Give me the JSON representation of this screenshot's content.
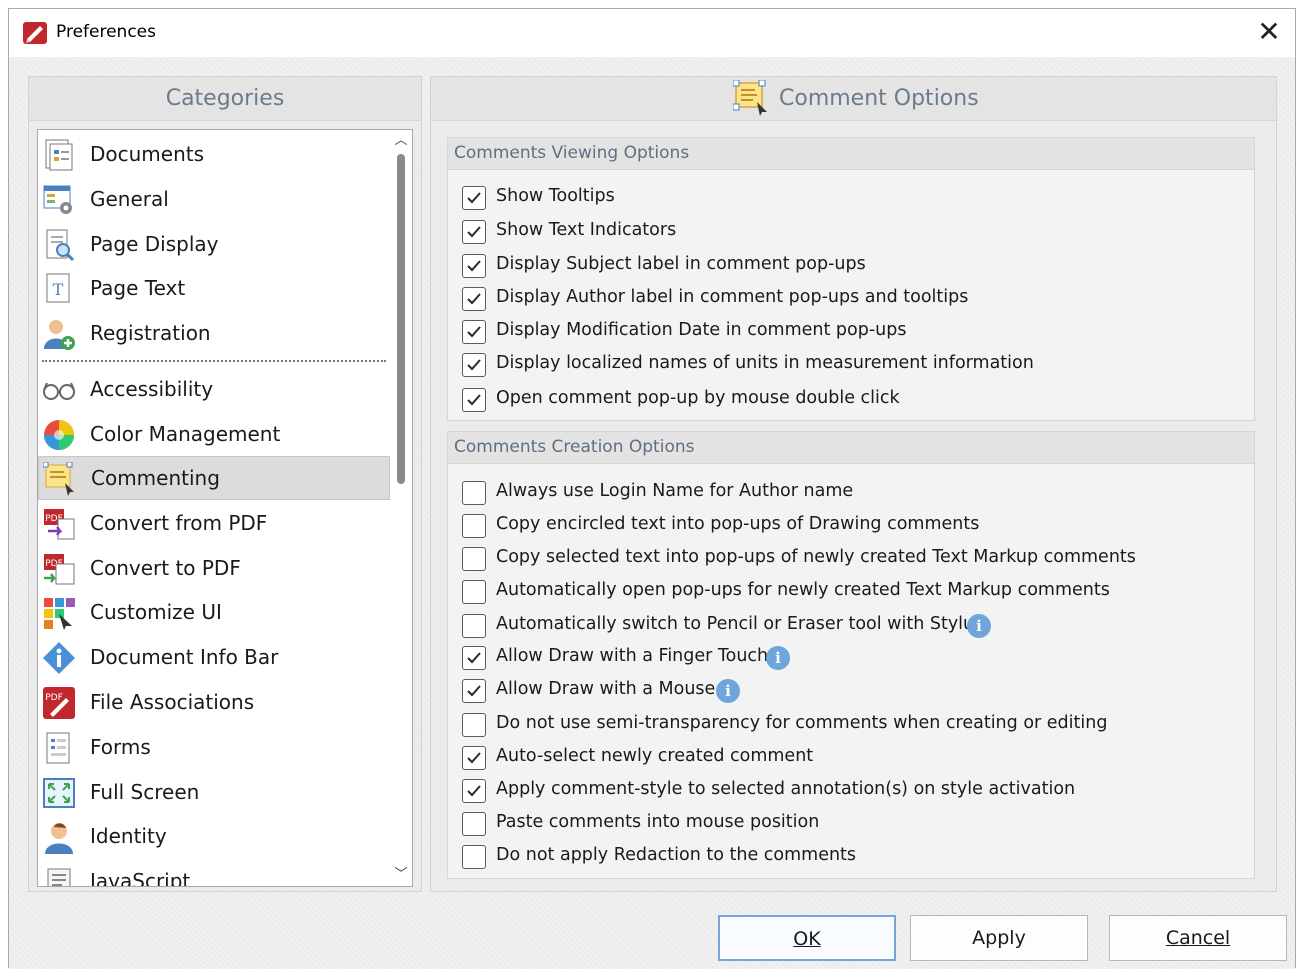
{
  "window": {
    "title": "Preferences",
    "close_symbol": "✕"
  },
  "categories": {
    "header": "Categories",
    "items": [
      {
        "label": "Documents",
        "icon": "documents-icon"
      },
      {
        "label": "General",
        "icon": "general-icon"
      },
      {
        "label": "Page Display",
        "icon": "page-display-icon"
      },
      {
        "label": "Page Text",
        "icon": "page-text-icon"
      },
      {
        "label": "Registration",
        "icon": "registration-icon"
      },
      {
        "label": "Accessibility",
        "icon": "accessibility-icon"
      },
      {
        "label": "Color Management",
        "icon": "color-management-icon"
      },
      {
        "label": "Commenting",
        "icon": "commenting-icon",
        "selected": true
      },
      {
        "label": "Convert from PDF",
        "icon": "convert-from-pdf-icon"
      },
      {
        "label": "Convert to PDF",
        "icon": "convert-to-pdf-icon"
      },
      {
        "label": "Customize UI",
        "icon": "customize-ui-icon"
      },
      {
        "label": "Document Info Bar",
        "icon": "document-info-bar-icon"
      },
      {
        "label": "File Associations",
        "icon": "file-associations-icon"
      },
      {
        "label": "Forms",
        "icon": "forms-icon"
      },
      {
        "label": "Full Screen",
        "icon": "full-screen-icon"
      },
      {
        "label": "Identity",
        "icon": "identity-icon"
      },
      {
        "label": "JavaScript",
        "icon": "javascript-icon"
      }
    ]
  },
  "options": {
    "header": "Comment Options",
    "viewing": {
      "title": "Comments Viewing Options",
      "items": [
        {
          "label": "Show Tooltips",
          "checked": true
        },
        {
          "label": "Show Text Indicators",
          "checked": true
        },
        {
          "label": "Display Subject label in comment pop-ups",
          "checked": true
        },
        {
          "label": "Display Author label in comment pop-ups and tooltips",
          "checked": true
        },
        {
          "label": "Display Modification Date in comment pop-ups",
          "checked": true
        },
        {
          "label": "Display localized names of units in measurement information",
          "checked": true
        },
        {
          "label": "Open comment pop-up by mouse double click",
          "checked": true
        }
      ]
    },
    "creation": {
      "title": "Comments Creation Options",
      "items": [
        {
          "label": "Always use Login Name for Author name",
          "checked": false
        },
        {
          "label": "Copy encircled text into pop-ups of Drawing comments",
          "checked": false
        },
        {
          "label": "Copy selected text into pop-ups of newly created Text Markup comments",
          "checked": false
        },
        {
          "label": "Automatically open pop-ups for newly created Text Markup comments",
          "checked": false
        },
        {
          "label": "Automatically switch to Pencil or Eraser tool with Stylus",
          "checked": false,
          "info": true
        },
        {
          "label": "Allow Draw with a Finger Touch",
          "checked": true,
          "info": true
        },
        {
          "label": "Allow Draw with a Mouse",
          "checked": true,
          "info": true
        },
        {
          "label": "Do not use semi-transparency for comments when creating or editing",
          "checked": false
        },
        {
          "label": "Auto-select newly created comment",
          "checked": true
        },
        {
          "label": "Apply comment-style to selected annotation(s) on style activation",
          "checked": true
        },
        {
          "label": "Paste comments into mouse position",
          "checked": false
        },
        {
          "label": "Do not apply Redaction to the comments",
          "checked": false
        }
      ]
    },
    "info_symbol": "i"
  },
  "buttons": {
    "ok": "OK",
    "apply": "Apply",
    "cancel": "Cancel"
  },
  "colors": {
    "accent": "#7aa3d6",
    "header_text": "#6b7b8c",
    "info": "#6ea5da"
  }
}
